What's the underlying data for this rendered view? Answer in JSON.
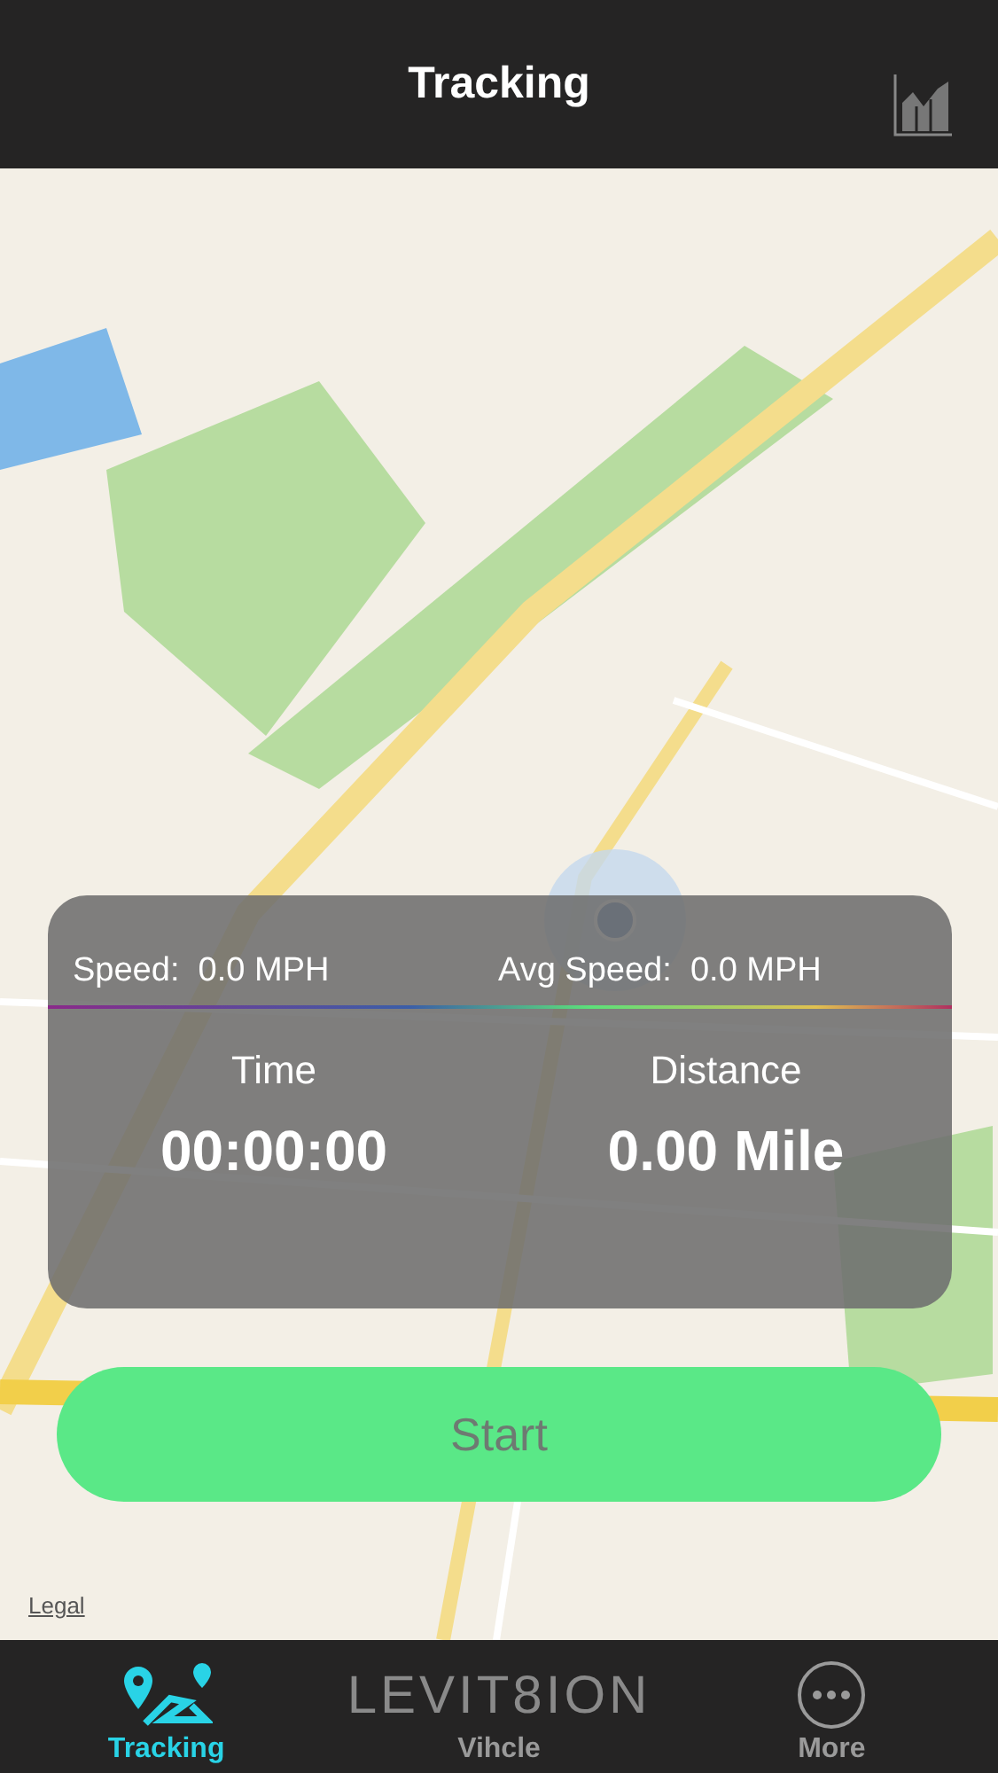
{
  "header": {
    "title": "Tracking"
  },
  "map": {
    "legal_link": "Legal"
  },
  "stats": {
    "speed_label": "Speed:",
    "speed_value": "0.0 MPH",
    "avg_speed_label": "Avg Speed:",
    "avg_speed_value": "0.0 MPH",
    "time_label": "Time",
    "time_value": "00:00:00",
    "distance_label": "Distance",
    "distance_value": "0.00 Mile"
  },
  "start_button": "Start",
  "tabs": [
    {
      "kind": "tracking",
      "label": "Tracking",
      "selected": true
    },
    {
      "kind": "logo",
      "logo": "LEVIT8ION",
      "label": "Vihcle",
      "selected": false
    },
    {
      "kind": "more",
      "label": "More",
      "selected": false
    }
  ]
}
